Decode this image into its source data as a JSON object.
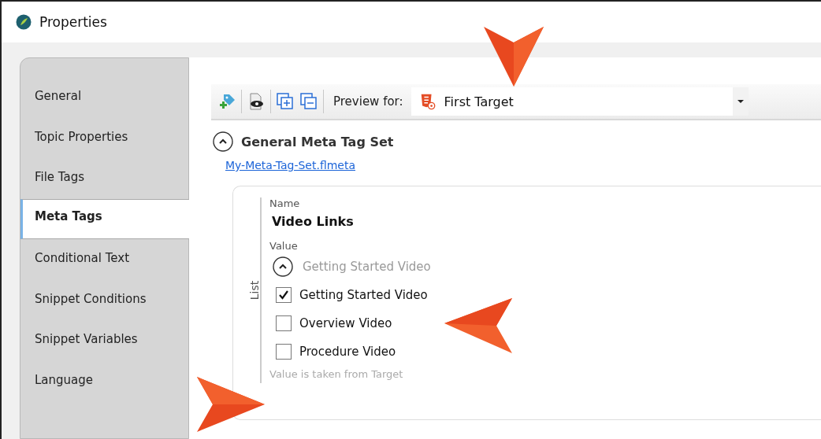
{
  "window": {
    "title": "Properties"
  },
  "tabs": [
    {
      "label": "General",
      "selected": false
    },
    {
      "label": "Topic Properties",
      "selected": false
    },
    {
      "label": "File Tags",
      "selected": false
    },
    {
      "label": "Meta Tags",
      "selected": true
    },
    {
      "label": "Conditional Text",
      "selected": false
    },
    {
      "label": "Snippet Conditions",
      "selected": false
    },
    {
      "label": "Snippet Variables",
      "selected": false
    },
    {
      "label": "Language",
      "selected": false
    }
  ],
  "toolbar": {
    "preview_label": "Preview for:",
    "preview_value": "First Target"
  },
  "section": {
    "title": "General Meta Tag Set",
    "expanded": true,
    "link": "My-Meta-Tag-Set.flmeta"
  },
  "card": {
    "side_label": "List",
    "name_label": "Name",
    "name_value": "Video Links",
    "value_label": "Value",
    "group": {
      "title": "Getting Started Video",
      "expanded": true
    },
    "items": [
      {
        "label": "Getting Started Video",
        "checked": true
      },
      {
        "label": "Overview Video",
        "checked": false
      },
      {
        "label": "Procedure Video",
        "checked": false
      }
    ],
    "note": "Value is taken from Target"
  }
}
